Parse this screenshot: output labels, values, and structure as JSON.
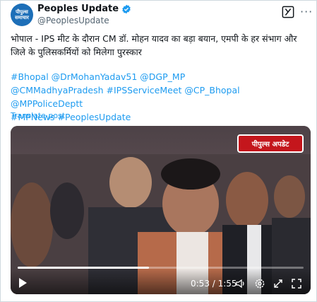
{
  "author": {
    "name": "Peoples Update",
    "handle": "@PeoplesUpdate",
    "avatar_text": "पीपुल्स समाचार"
  },
  "post": {
    "text": "भोपाल - IPS मीट के दौरान CM डॉ. मोहन यादव का बड़ा बयान, एमपी के हर संभाग और जिले के पुलिसकर्मियों को मिलेगा पुरस्कार",
    "hashtags_line1": "#Bhopal @DrMohanYadav51 @DGP_MP",
    "hashtags_line2": "@CMMadhyaPradesh #IPSServiceMeet @CP_Bhopal @MPPoliceDeptt",
    "hashtags_line3": "#MPNews #PeoplesUpdate",
    "translate_label": "Translate post"
  },
  "video": {
    "logo_text": "पीपुल्स अपडेट",
    "time": "0:53 / 1:55",
    "progress": 0.46
  },
  "icons": {
    "verified": "verified-badge-icon",
    "grok": "grok-icon",
    "more": "more-icon",
    "play": "play-icon",
    "volume": "volume-icon",
    "settings": "settings-icon",
    "pip": "picture-in-picture-icon",
    "fullscreen": "fullscreen-icon"
  },
  "colors": {
    "link": "#1d9bf0",
    "verified": "#1d9bf0",
    "logo_red": "#c4161c"
  }
}
